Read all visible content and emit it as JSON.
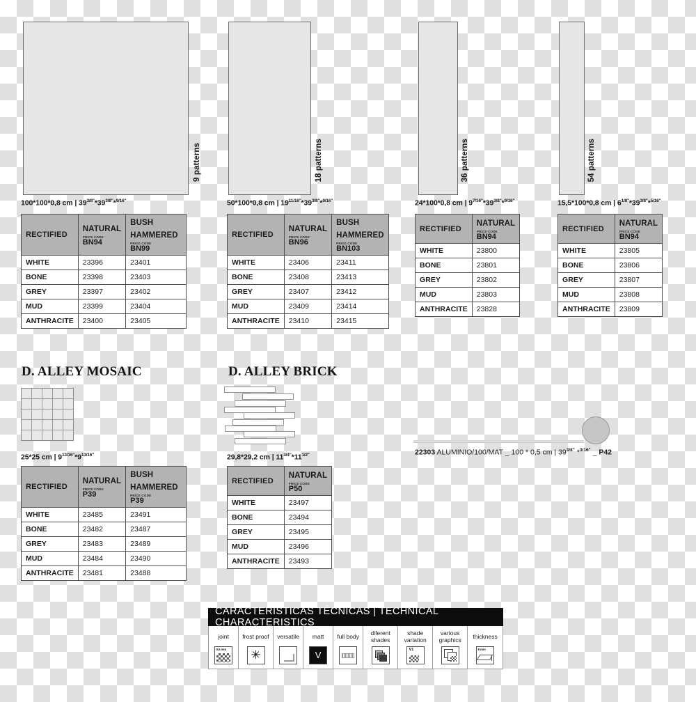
{
  "tiles": [
    {
      "name": "100x100",
      "patterns_label": "9 patterns",
      "dimension": {
        "metric": "100*100*0,8 cm",
        "separator": "|",
        "imperial": [
          {
            "whole": "39",
            "frac": "3/8\""
          },
          {
            "whole": "*39",
            "frac": "3/8\""
          },
          {
            "whole": "*",
            "frac": "9/16\""
          }
        ]
      },
      "table": {
        "head_first": "RECTIFIED",
        "price_code_label": "PRICE CODE",
        "finishes": [
          {
            "name": "NATURAL",
            "code": "BN94"
          },
          {
            "name": "BUSH HAMMERED",
            "code": "BN99"
          }
        ],
        "rows": [
          {
            "colour": "WHITE",
            "codes": [
              "23396",
              "23401"
            ]
          },
          {
            "colour": "BONE",
            "codes": [
              "23398",
              "23403"
            ]
          },
          {
            "colour": "GREY",
            "codes": [
              "23397",
              "23402"
            ]
          },
          {
            "colour": "MUD",
            "codes": [
              "23399",
              "23404"
            ]
          },
          {
            "colour": "ANTHRACITE",
            "codes": [
              "23400",
              "23405"
            ]
          }
        ]
      }
    },
    {
      "name": "50x100",
      "patterns_label": "18 patterns",
      "dimension": {
        "metric": "50*100*0,8 cm",
        "separator": "|",
        "imperial": [
          {
            "whole": "19",
            "frac": "11/16\""
          },
          {
            "whole": "*39",
            "frac": "3/8\""
          },
          {
            "whole": "*",
            "frac": "9/16\""
          }
        ]
      },
      "table": {
        "head_first": "RECTIFIED",
        "price_code_label": "PRICE CODE",
        "finishes": [
          {
            "name": "NATURAL",
            "code": "BN96"
          },
          {
            "name": "BUSH HAMMERED",
            "code": "BN103"
          }
        ],
        "rows": [
          {
            "colour": "WHITE",
            "codes": [
              "23406",
              "23411"
            ]
          },
          {
            "colour": "BONE",
            "codes": [
              "23408",
              "23413"
            ]
          },
          {
            "colour": "GREY",
            "codes": [
              "23407",
              "23412"
            ]
          },
          {
            "colour": "MUD",
            "codes": [
              "23409",
              "23414"
            ]
          },
          {
            "colour": "ANTHRACITE",
            "codes": [
              "23410",
              "23415"
            ]
          }
        ]
      }
    },
    {
      "name": "24x100",
      "patterns_label": "36 patterns",
      "dimension": {
        "metric": "24*100*0,8 cm",
        "separator": "|",
        "imperial": [
          {
            "whole": "9",
            "frac": "7/16\""
          },
          {
            "whole": "*39",
            "frac": "3/8\""
          },
          {
            "whole": "*",
            "frac": "9/16\""
          }
        ]
      },
      "table": {
        "head_first": "RECTIFIED",
        "price_code_label": "PRICE CODE",
        "finishes": [
          {
            "name": "NATURAL",
            "code": "BN94"
          }
        ],
        "rows": [
          {
            "colour": "WHITE",
            "codes": [
              "23800"
            ]
          },
          {
            "colour": "BONE",
            "codes": [
              "23801"
            ]
          },
          {
            "colour": "GREY",
            "codes": [
              "23802"
            ]
          },
          {
            "colour": "MUD",
            "codes": [
              "23803"
            ]
          },
          {
            "colour": "ANTHRACITE",
            "codes": [
              "23828"
            ]
          }
        ]
      }
    },
    {
      "name": "15,5x100",
      "patterns_label": "54 patterns",
      "dimension": {
        "metric": "15,5*100*0,8 cm",
        "separator": "|",
        "imperial": [
          {
            "whole": "6",
            "frac": "1/8\""
          },
          {
            "whole": "*39",
            "frac": "3/8\""
          },
          {
            "whole": "*",
            "frac": "5/16\""
          }
        ]
      },
      "table": {
        "head_first": "RECTIFIED",
        "price_code_label": "PRICE CODE",
        "finishes": [
          {
            "name": "NATURAL",
            "code": "BN94"
          }
        ],
        "rows": [
          {
            "colour": "WHITE",
            "codes": [
              "23805"
            ]
          },
          {
            "colour": "BONE",
            "codes": [
              "23806"
            ]
          },
          {
            "colour": "GREY",
            "codes": [
              "23807"
            ]
          },
          {
            "colour": "MUD",
            "codes": [
              "23808"
            ]
          },
          {
            "colour": "ANTHRACITE",
            "codes": [
              "23809"
            ]
          }
        ]
      }
    }
  ],
  "mosaic": {
    "title": "D. ALLEY MOSAIC",
    "dimension": {
      "metric": "25*25 cm",
      "separator": "|",
      "imperial": [
        {
          "whole": "9",
          "frac": "13/16\""
        },
        {
          "whole": "*9",
          "frac": "13/16\""
        }
      ]
    },
    "table": {
      "head_first": "RECTIFIED",
      "price_code_label": "PRICE CODE",
      "finishes": [
        {
          "name": "NATURAL",
          "code": "P39"
        },
        {
          "name": "BUSH HAMMERED",
          "code": "P39"
        }
      ],
      "rows": [
        {
          "colour": "WHITE",
          "codes": [
            "23485",
            "23491"
          ]
        },
        {
          "colour": "BONE",
          "codes": [
            "23482",
            "23487"
          ]
        },
        {
          "colour": "GREY",
          "codes": [
            "23483",
            "23489"
          ]
        },
        {
          "colour": "MUD",
          "codes": [
            "23484",
            "23490"
          ]
        },
        {
          "colour": "ANTHRACITE",
          "codes": [
            "23481",
            "23488"
          ]
        }
      ]
    }
  },
  "brick": {
    "title": "D. ALLEY BRICK",
    "dimension": {
      "metric": "29,8*29,2 cm",
      "separator": "|",
      "imperial": [
        {
          "whole": "11",
          "frac": "3/4\""
        },
        {
          "whole": "*11",
          "frac": "1/2\""
        }
      ]
    },
    "table": {
      "head_first": "RECTIFIED",
      "price_code_label": "PRICE CODE",
      "finishes": [
        {
          "name": "NATURAL",
          "code": "P50"
        }
      ],
      "rows": [
        {
          "colour": "WHITE",
          "codes": [
            "23497"
          ]
        },
        {
          "colour": "BONE",
          "codes": [
            "23494"
          ]
        },
        {
          "colour": "GREY",
          "codes": [
            "23495"
          ]
        },
        {
          "colour": "MUD",
          "codes": [
            "23496"
          ]
        },
        {
          "colour": "ANTHRACITE",
          "codes": [
            "23493"
          ]
        }
      ]
    }
  },
  "trim": {
    "code": "22303",
    "name": "ALUMINIO/100/MAT",
    "sep1": "_",
    "metric": "100 * 0,5 cm",
    "sep2": "|",
    "imp_whole1": "39",
    "imp_frac1": "3/8\"",
    "imp_mid": "*",
    "imp_frac2": "3/16\"",
    "sep3": "_",
    "price_code": "P42"
  },
  "tech": {
    "heading": "CARACTERÍSTICAS TÉCNICAS | TECHNICAL CHARACTERISTICS",
    "items": [
      {
        "label": "joint",
        "icon": "joint-icon",
        "value": "0,5 mm"
      },
      {
        "label": "frost proof",
        "icon": "snowflake-icon",
        "value": "✳"
      },
      {
        "label": "versatile",
        "icon": "versatile-icon",
        "value": ""
      },
      {
        "label": "matt",
        "icon": "matt-icon",
        "value": "V"
      },
      {
        "label": "full body",
        "icon": "full-body-icon",
        "value": ""
      },
      {
        "label": "diferent shades",
        "icon": "different-shades-icon",
        "value": ""
      },
      {
        "label": "shade variation",
        "icon": "shade-variation-icon",
        "value": "V1"
      },
      {
        "label": "various graphics",
        "icon": "various-graphics-icon",
        "value": ""
      },
      {
        "label": "thickness",
        "icon": "thickness-icon",
        "value": "8 mm"
      }
    ]
  }
}
